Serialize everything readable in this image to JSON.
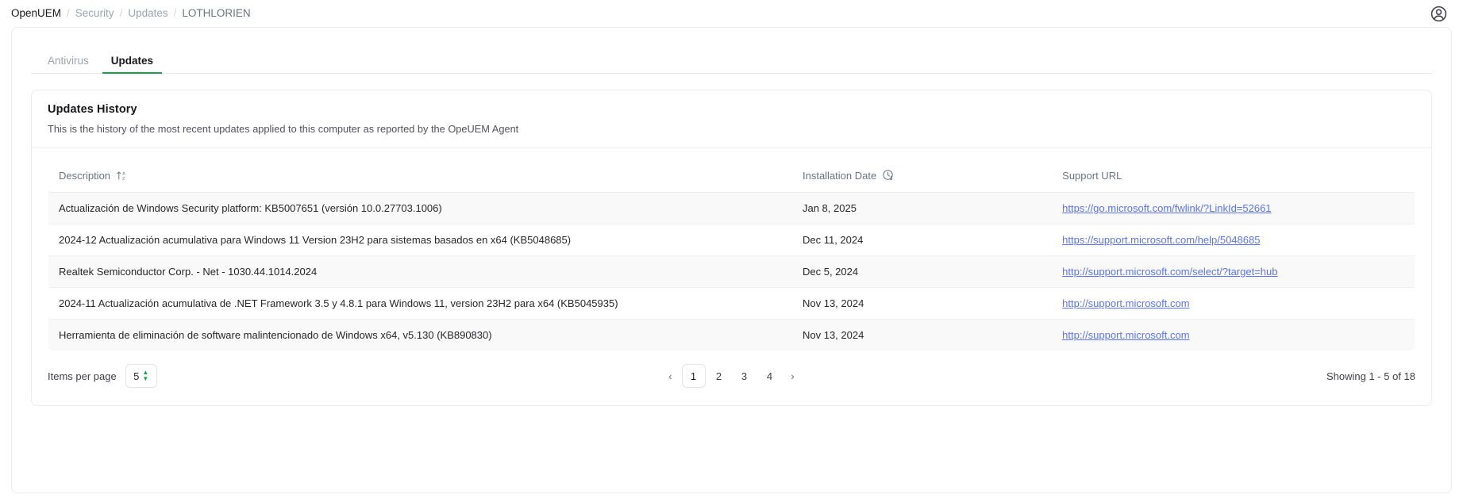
{
  "breadcrumb": {
    "root": "OpenUEM",
    "separator": "/",
    "items": [
      "Security",
      "Updates"
    ],
    "current": "LOTHLORIEN"
  },
  "topbar": {
    "account_icon": "user-circle-icon"
  },
  "tabs": [
    {
      "label": "Antivirus",
      "active": false
    },
    {
      "label": "Updates",
      "active": true
    }
  ],
  "card": {
    "title": "Updates History",
    "subtitle": "This is the history of the most recent updates applied to this computer as reported by the OpeUEM Agent"
  },
  "table": {
    "columns": [
      {
        "label": "Description",
        "icon": "sort-az-ascending-icon"
      },
      {
        "label": "Installation Date",
        "icon": "clock-arrow-down-icon"
      },
      {
        "label": "Support URL",
        "icon": ""
      }
    ],
    "rows": [
      {
        "description": "Actualización de Windows Security platform: KB5007651 (versión 10.0.27703.1006)",
        "date": "Jan 8, 2025",
        "url": "https://go.microsoft.com/fwlink/?LinkId=52661"
      },
      {
        "description": "2024-12 Actualización acumulativa para Windows 11 Version 23H2 para sistemas basados en x64 (KB5048685)",
        "date": "Dec 11, 2024",
        "url": "https://support.microsoft.com/help/5048685"
      },
      {
        "description": "Realtek Semiconductor Corp. - Net - 1030.44.1014.2024",
        "date": "Dec 5, 2024",
        "url": "http://support.microsoft.com/select/?target=hub"
      },
      {
        "description": "2024-11 Actualización acumulativa de .NET Framework 3.5 y 4.8.1 para Windows 11, version 23H2 para x64 (KB5045935)",
        "date": "Nov 13, 2024",
        "url": "http://support.microsoft.com"
      },
      {
        "description": "Herramienta de eliminación de software malintencionado de Windows x64, v5.130 (KB890830)",
        "date": "Nov 13, 2024",
        "url": "http://support.microsoft.com"
      }
    ]
  },
  "footer": {
    "items_per_page_label": "Items per page",
    "items_per_page_value": "5",
    "pagination": {
      "prev": "‹",
      "pages": [
        "1",
        "2",
        "3",
        "4"
      ],
      "current": "1",
      "next": "›"
    },
    "showing": "Showing 1 - 5 of 18"
  },
  "colors": {
    "accent": "#16a34a",
    "link": "#5b74f0",
    "row_alt": "#f9f9fa",
    "border": "#ececf0"
  }
}
